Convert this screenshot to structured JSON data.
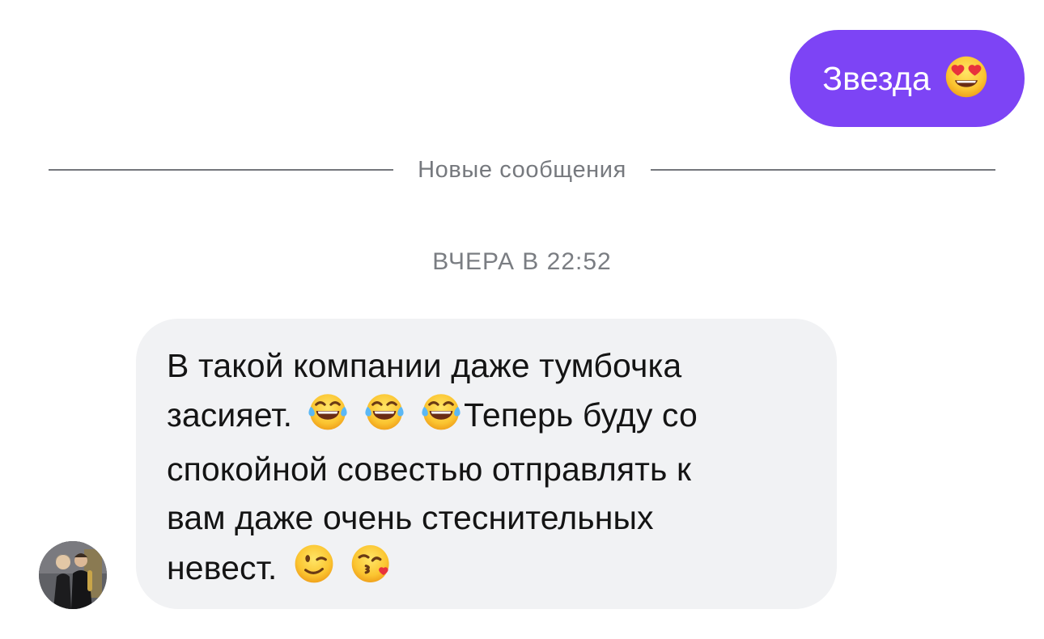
{
  "outgoing": {
    "text": "Звезда",
    "emoji": "heart-eyes-face"
  },
  "divider": {
    "label": "Новые сообщения"
  },
  "date_stamp": "ВЧЕРА В 22:52",
  "incoming": {
    "line1": "В такой компании даже тумбочка",
    "line2a": "засияет.",
    "line2b": "Теперь буду со",
    "line3": "спокойной совестью отправлять к",
    "line4": "вам даже очень стеснительных",
    "line5": "невест.",
    "emojis": [
      "tears-of-joy-face",
      "tears-of-joy-face",
      "tears-of-joy-face",
      "winking-face",
      "kissing-heart-face"
    ]
  },
  "colors": {
    "outgoing_bubble": "#7d44f5",
    "incoming_bubble": "#f1f2f4",
    "meta_text": "#76797e"
  }
}
